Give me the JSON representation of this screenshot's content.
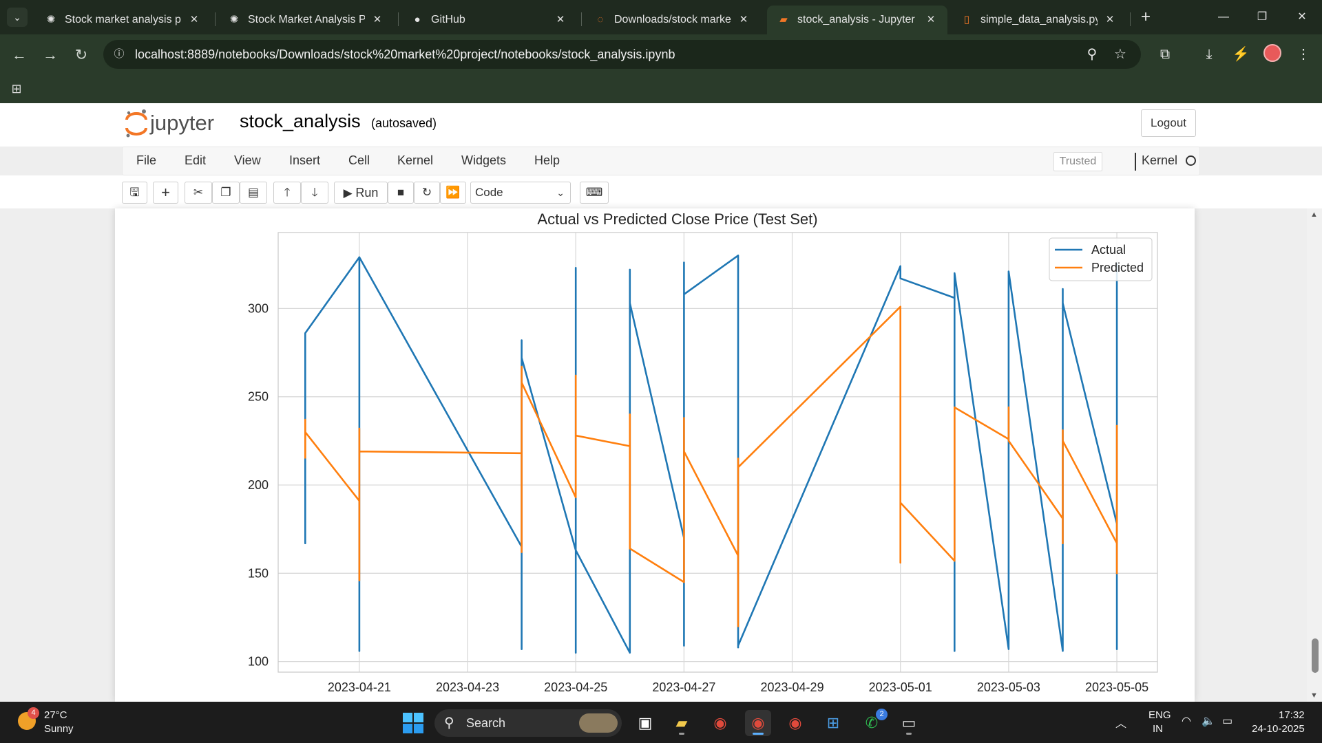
{
  "browser": {
    "tabs": [
      {
        "label": "Stock market analysis proje",
        "icon": "openai-icon",
        "active": false
      },
      {
        "label": "Stock Market Analysis Proj",
        "icon": "openai-icon",
        "active": false
      },
      {
        "label": "GitHub",
        "icon": "github-icon",
        "active": false
      },
      {
        "label": "Downloads/stock market p",
        "icon": "jupyter-icon",
        "active": false
      },
      {
        "label": "stock_analysis - Jupyter No",
        "icon": "jupyter-notebook-icon",
        "active": true
      },
      {
        "label": "simple_data_analysis.py - J",
        "icon": "document-icon",
        "active": false
      }
    ],
    "url": "localhost:8889/notebooks/Downloads/stock%20market%20project/notebooks/stock_analysis.ipynb"
  },
  "jupyter": {
    "logo_text": "jupyter",
    "notebook_name": "stock_analysis",
    "autosave": "(autosaved)",
    "logout_label": "Logout",
    "menu": [
      "File",
      "Edit",
      "View",
      "Insert",
      "Cell",
      "Kernel",
      "Widgets",
      "Help"
    ],
    "trusted_label": "Trusted",
    "kernel_label": "Kernel",
    "run_label": "Run",
    "cell_type": "Code"
  },
  "chart_data": {
    "type": "line",
    "title": "Actual vs Predicted Close Price (Test Set)",
    "xlabel": "",
    "ylabel": "",
    "x_ticks": [
      "2023-04-21",
      "2023-04-23",
      "2023-04-25",
      "2023-04-27",
      "2023-04-29",
      "2023-05-01",
      "2023-05-03",
      "2023-05-05"
    ],
    "x_range": [
      "2023-04-19T12:00",
      "2023-05-05T18:00"
    ],
    "y_ticks": [
      100,
      150,
      200,
      250,
      300
    ],
    "ylim": [
      94,
      343
    ],
    "grid": true,
    "legend": "top-right",
    "series": [
      {
        "name": "Actual",
        "color": "#1f77b4",
        "points": [
          [
            "2023-04-20",
            286
          ],
          [
            "2023-04-20",
            167
          ],
          [
            "2023-04-20",
            286
          ],
          [
            "2023-04-21",
            329
          ],
          [
            "2023-04-21",
            106
          ],
          [
            "2023-04-21",
            329
          ],
          [
            "2023-04-24",
            165
          ],
          [
            "2023-04-24",
            107
          ],
          [
            "2023-04-24",
            282
          ],
          [
            "2023-04-24",
            272
          ],
          [
            "2023-04-25",
            163
          ],
          [
            "2023-04-25",
            105
          ],
          [
            "2023-04-25",
            323
          ],
          [
            "2023-04-25",
            163
          ],
          [
            "2023-04-26",
            105
          ],
          [
            "2023-04-26",
            322
          ],
          [
            "2023-04-26",
            303
          ],
          [
            "2023-04-27",
            170
          ],
          [
            "2023-04-27",
            109
          ],
          [
            "2023-04-27",
            326
          ],
          [
            "2023-04-27",
            308
          ],
          [
            "2023-04-28",
            330
          ],
          [
            "2023-04-28",
            108
          ],
          [
            "2023-04-28",
            109
          ],
          [
            "2023-05-01",
            324
          ],
          [
            "2023-05-01",
            317
          ],
          [
            "2023-05-02",
            306
          ],
          [
            "2023-05-02",
            106
          ],
          [
            "2023-05-02",
            320
          ],
          [
            "2023-05-03",
            107
          ],
          [
            "2023-05-03",
            321
          ],
          [
            "2023-05-04",
            106
          ],
          [
            "2023-05-04",
            311
          ],
          [
            "2023-05-04",
            303
          ],
          [
            "2023-05-05",
            178
          ],
          [
            "2023-05-05",
            107
          ],
          [
            "2023-05-05",
            326
          ]
        ]
      },
      {
        "name": "Predicted",
        "color": "#ff7f0e",
        "points": [
          [
            "2023-04-20",
            215
          ],
          [
            "2023-04-20",
            237
          ],
          [
            "2023-04-20",
            230
          ],
          [
            "2023-04-21",
            191
          ],
          [
            "2023-04-21",
            146
          ],
          [
            "2023-04-21",
            232
          ],
          [
            "2023-04-21",
            219
          ],
          [
            "2023-04-24",
            218
          ],
          [
            "2023-04-24",
            162
          ],
          [
            "2023-04-24",
            267
          ],
          [
            "2023-04-24",
            258
          ],
          [
            "2023-04-25",
            193
          ],
          [
            "2023-04-25",
            262
          ],
          [
            "2023-04-25",
            228
          ],
          [
            "2023-04-26",
            222
          ],
          [
            "2023-04-26",
            240
          ],
          [
            "2023-04-26",
            164
          ],
          [
            "2023-04-27",
            145
          ],
          [
            "2023-04-27",
            238
          ],
          [
            "2023-04-27",
            219
          ],
          [
            "2023-04-28",
            160
          ],
          [
            "2023-04-28",
            120
          ],
          [
            "2023-04-28",
            215
          ],
          [
            "2023-04-28",
            210
          ],
          [
            "2023-05-01",
            301
          ],
          [
            "2023-05-01",
            156
          ],
          [
            "2023-05-01",
            190
          ],
          [
            "2023-05-02",
            157
          ],
          [
            "2023-05-02",
            244
          ],
          [
            "2023-05-03",
            226
          ],
          [
            "2023-05-03",
            244
          ],
          [
            "2023-05-03",
            225
          ],
          [
            "2023-05-04",
            181
          ],
          [
            "2023-05-04",
            167
          ],
          [
            "2023-05-04",
            231
          ],
          [
            "2023-05-04",
            225
          ],
          [
            "2023-05-05",
            167
          ],
          [
            "2023-05-05",
            150
          ],
          [
            "2023-05-05",
            234
          ]
        ]
      }
    ]
  },
  "taskbar": {
    "weather_badge": "4",
    "weather_temp": "27°C",
    "weather_cond": "Sunny",
    "search_label": "Search",
    "whatsapp_badge": "2",
    "lang_top": "ENG",
    "lang_bot": "IN",
    "time": "17:32",
    "date": "24-10-2025"
  }
}
